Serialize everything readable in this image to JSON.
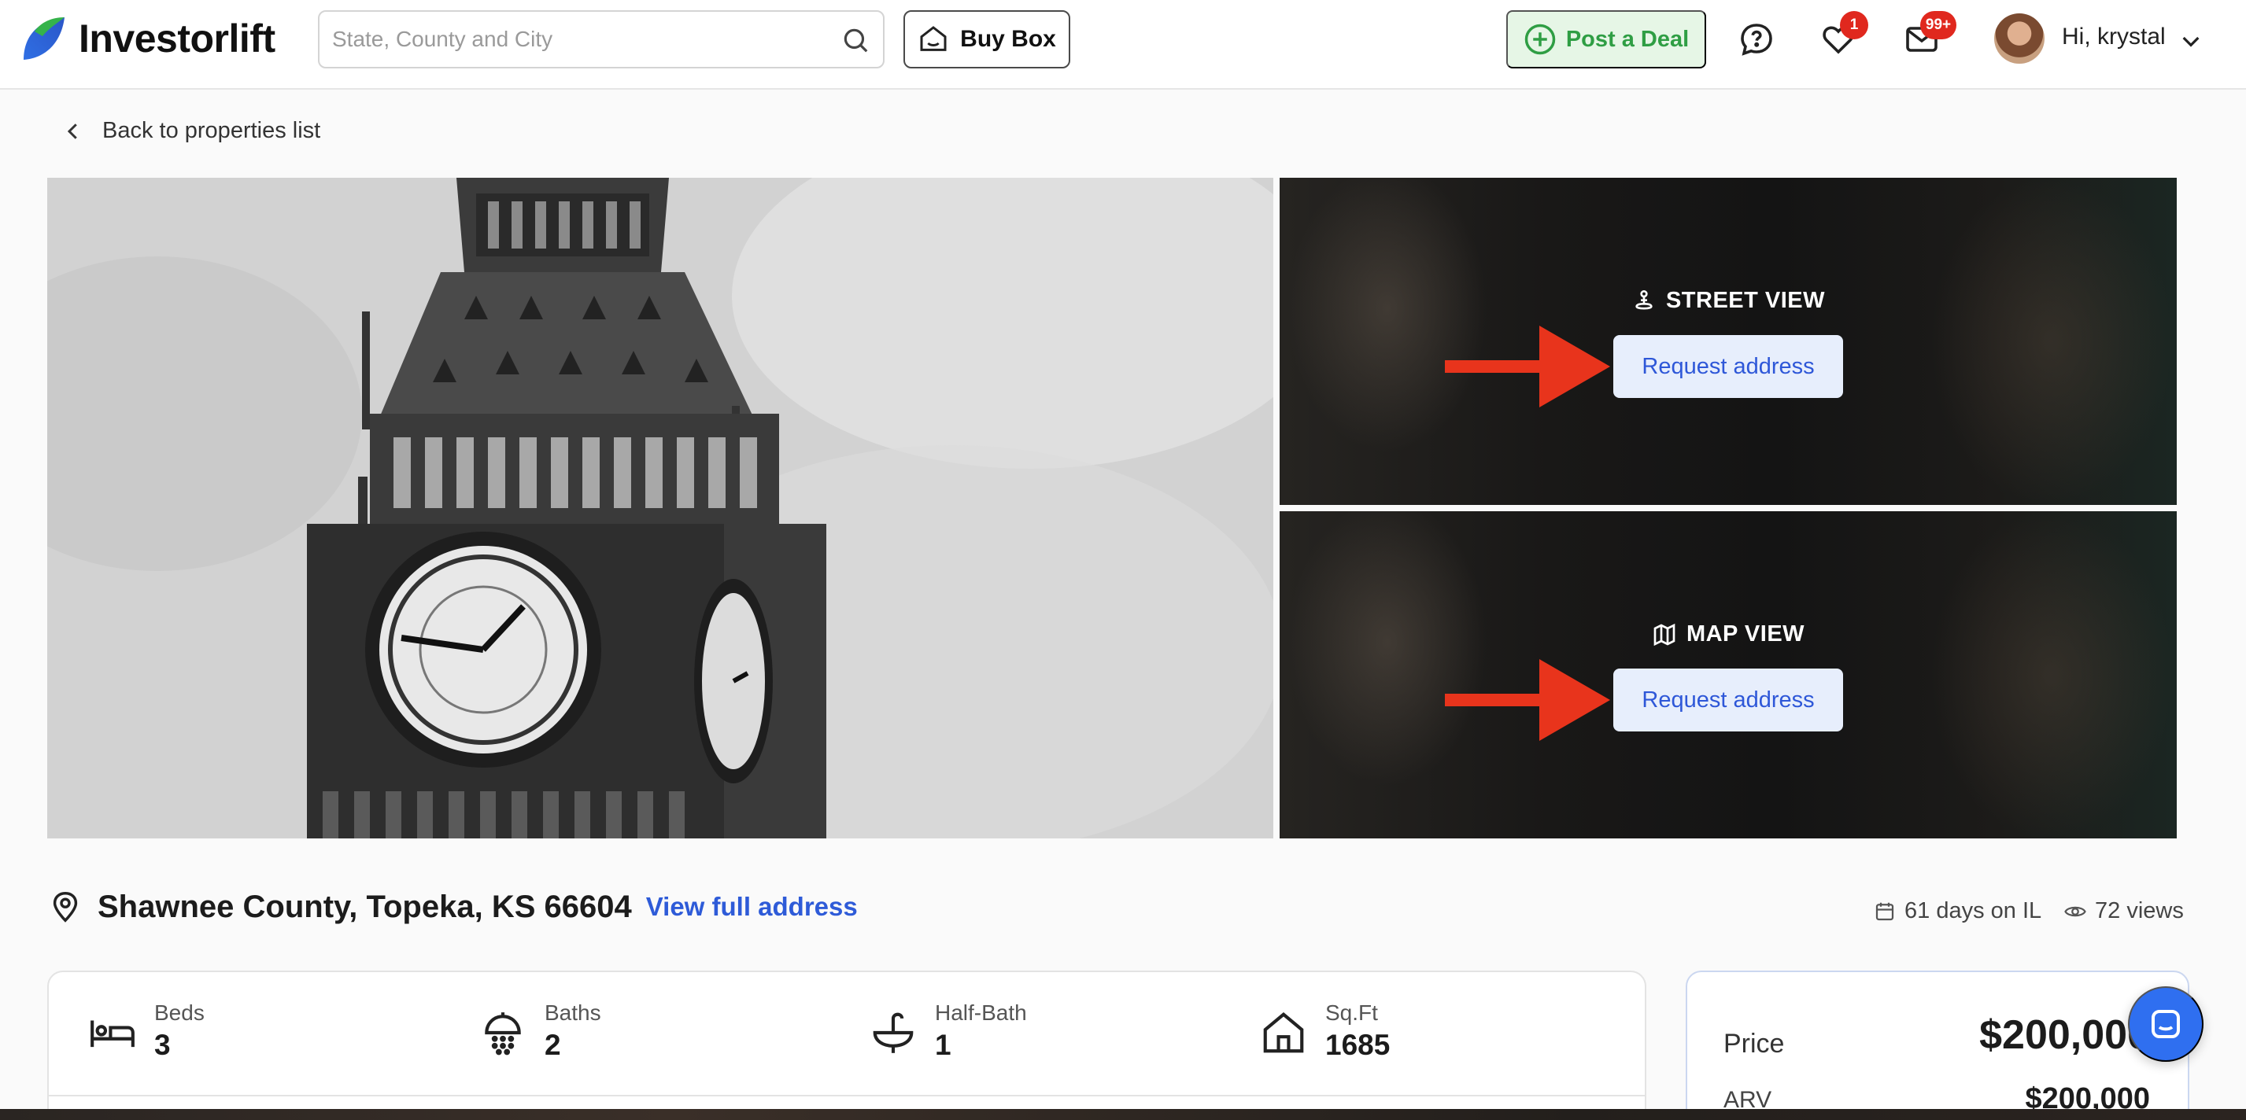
{
  "app": {
    "brand": "Investorlift"
  },
  "header": {
    "search": {
      "placeholder": "State, County and City",
      "value": ""
    },
    "buy_box_label": "Buy Box",
    "post_deal_label": "Post a Deal",
    "favorites_badge": "1",
    "messages_badge": "99+",
    "greeting": "Hi, krystal"
  },
  "nav": {
    "back_label": "Back to properties list"
  },
  "gallery": {
    "street_view": {
      "title": "STREET VIEW",
      "button_label": "Request address"
    },
    "map_view": {
      "title": "MAP VIEW",
      "button_label": "Request address"
    }
  },
  "property": {
    "location": "Shawnee County, Topeka, KS 66604",
    "view_full_address_label": "View full address",
    "days_on": "61 days on IL",
    "views": "72 views"
  },
  "stats": [
    {
      "label": "Beds",
      "value": "3",
      "icon": "bed-icon"
    },
    {
      "label": "Baths",
      "value": "2",
      "icon": "shower-icon"
    },
    {
      "label": "Half-Bath",
      "value": "1",
      "icon": "sink-icon"
    },
    {
      "label": "Sq.Ft",
      "value": "1685",
      "icon": "house-icon"
    }
  ],
  "pricing": {
    "price_label": "Price",
    "price_value": "$200,000",
    "arv_label": "ARV",
    "arv_value": "$200,000"
  },
  "colors": {
    "brand_green": "#2f9e44",
    "link_blue": "#2e5bd8",
    "badge_red": "#e0281e",
    "annotation_arrow": "#e8341c"
  }
}
